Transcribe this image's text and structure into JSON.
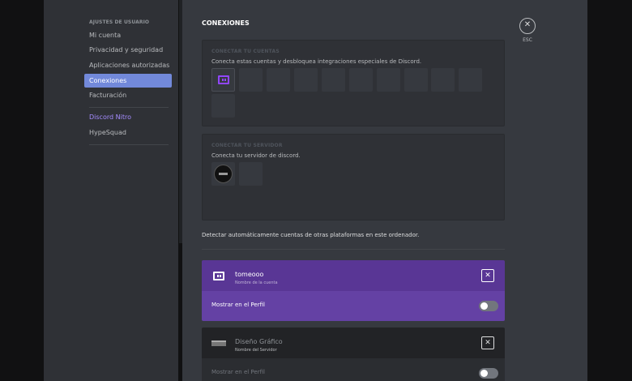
{
  "sidebar": {
    "section_header": "AJUSTES DE USUARIO",
    "items": [
      {
        "label": "Mi cuenta"
      },
      {
        "label": "Privacidad y seguridad"
      },
      {
        "label": "Aplicaciones autorizadas"
      },
      {
        "label": "Conexiones",
        "active": true
      },
      {
        "label": "Facturación"
      },
      {
        "label": "Discord Nitro"
      },
      {
        "label": "HypeSquad"
      }
    ]
  },
  "main": {
    "title": "CONEXIONES",
    "close_label": "ESC",
    "connect_accounts": {
      "header": "CONECTAR TU CUENTAS",
      "description": "Conecta estas cuentas y desbloquea integraciones especiales de Discord."
    },
    "connect_server": {
      "header": "CONECTAR TU SERVIDOR",
      "description": "Conecta tu servidor de discord."
    },
    "detect_text": "Detectar automáticamente cuentas de otras plataformas en este ordenador.",
    "connections": [
      {
        "name": "tomeooo",
        "subtitle": "Nombre de la cuenta",
        "show_label": "Mostrar en el Perfil",
        "icon": "twitch-icon",
        "toggle_on": false
      },
      {
        "name": "Diseño Gráfico",
        "subtitle": "Nombre del Servidor",
        "show_label": "Mostrar en el Perfil",
        "icon": "server-icon",
        "toggle_on": false
      }
    ]
  },
  "colors": {
    "accent": "#7289da",
    "twitch": "#6441a4",
    "nitro": "#a58cff",
    "background": "#36393f",
    "sidebar": "#2f3136"
  }
}
